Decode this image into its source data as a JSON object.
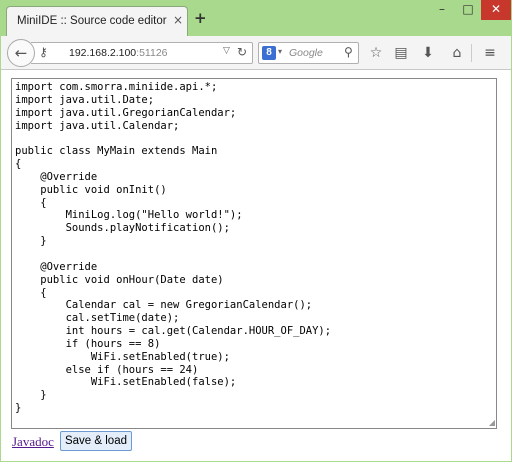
{
  "browser": {
    "tab_title": "MiniIDE :: Source code editor",
    "tab_close_glyph": "×",
    "new_tab_glyph": "+",
    "window_controls": {
      "minimize": "–",
      "maximize": "□",
      "close": "✕"
    },
    "url_host": "192.168.2.100",
    "url_port": ":51126",
    "search_placeholder": "Google",
    "search_engine_letter": "8",
    "icons": [
      "back-icon",
      "key-icon",
      "url-dropdown-icon",
      "reload-icon",
      "google-icon",
      "search-icon",
      "bookmark-star-icon",
      "clipboard-icon",
      "download-icon",
      "home-icon",
      "menu-icon"
    ]
  },
  "editor": {
    "code": "import com.smorra.miniide.api.*;\nimport java.util.Date;\nimport java.util.GregorianCalendar;\nimport java.util.Calendar;\n\npublic class MyMain extends Main\n{\n    @Override\n    public void onInit()\n    {\n        MiniLog.log(\"Hello world!\");\n        Sounds.playNotification();\n    }\n\n    @Override\n    public void onHour(Date date)\n    {\n        Calendar cal = new GregorianCalendar();\n        cal.setTime(date);\n        int hours = cal.get(Calendar.HOUR_OF_DAY);\n        if (hours == 8)\n            WiFi.setEnabled(true);\n        else if (hours == 24)\n            WiFi.setEnabled(false);\n    }\n}"
  },
  "footer": {
    "javadoc_label": "Javadoc",
    "save_label": "Save & load"
  }
}
